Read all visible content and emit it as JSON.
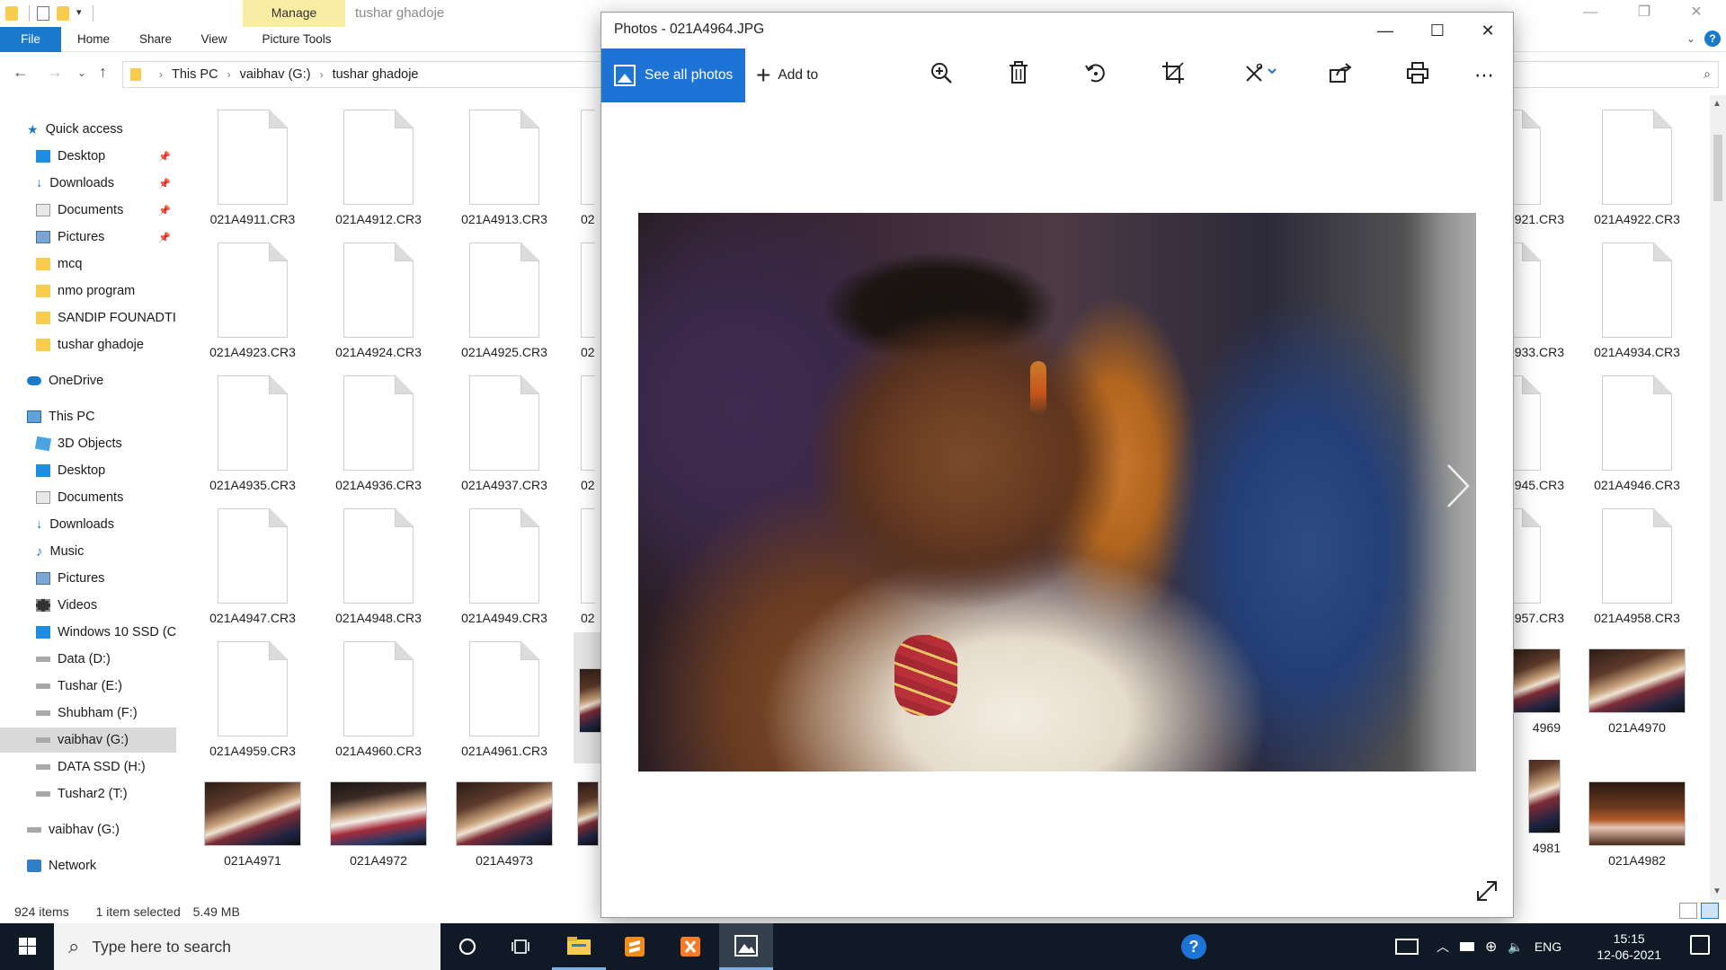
{
  "explorer": {
    "title": "tushar ghadoje",
    "context_tab": "Manage",
    "ribbon_tabs": [
      "File",
      "Home",
      "Share",
      "View",
      "Picture Tools"
    ],
    "breadcrumb": [
      "This PC",
      "vaibhav  (G:)",
      "tushar ghadoje"
    ],
    "nav": {
      "quick_access": "Quick access",
      "quick_items": [
        "Desktop",
        "Downloads",
        "Documents",
        "Pictures",
        "mcq",
        "nmo program",
        "SANDIP FOUNADTIO",
        "tushar ghadoje"
      ],
      "onedrive": "OneDrive",
      "this_pc": "This PC",
      "pc_items": [
        "3D Objects",
        "Desktop",
        "Documents",
        "Downloads",
        "Music",
        "Pictures",
        "Videos",
        "Windows 10 SSD (C",
        "Data (D:)",
        "Tushar (E:)",
        "Shubham (F:)",
        "vaibhav  (G:)",
        "DATA SSD (H:)",
        "Tushar2 (T:)"
      ],
      "drive_root": "vaibhav  (G:)",
      "network": "Network"
    },
    "files_left": [
      [
        "021A4911.CR3",
        "021A4912.CR3",
        "021A4913.CR3"
      ],
      [
        "021A4923.CR3",
        "021A4924.CR3",
        "021A4925.CR3"
      ],
      [
        "021A4935.CR3",
        "021A4936.CR3",
        "021A4937.CR3"
      ],
      [
        "021A4947.CR3",
        "021A4948.CR3",
        "021A4949.CR3"
      ],
      [
        "021A4959.CR3",
        "021A4960.CR3",
        "021A4961.CR3"
      ],
      [
        "021A4971",
        "021A4972",
        "021A4973"
      ]
    ],
    "files_partial_left": [
      "02",
      "02",
      "02",
      "02"
    ],
    "files_right_partial": [
      "921.CR3",
      "933.CR3",
      "945.CR3",
      "957.CR3",
      "4969",
      "4981"
    ],
    "files_right": [
      "021A4922.CR3",
      "021A4934.CR3",
      "021A4946.CR3",
      "021A4958.CR3",
      "021A4970",
      "021A4982"
    ],
    "status": {
      "items": "924 items",
      "selected": "1 item selected",
      "size": "5.49 MB"
    }
  },
  "photos": {
    "title": "Photos - 021A4964.JPG",
    "see_all": "See all photos",
    "add_to": "Add to"
  },
  "taskbar": {
    "search_placeholder": "Type here to search",
    "lang": "ENG",
    "time": "15:15",
    "date": "12-06-2021"
  }
}
